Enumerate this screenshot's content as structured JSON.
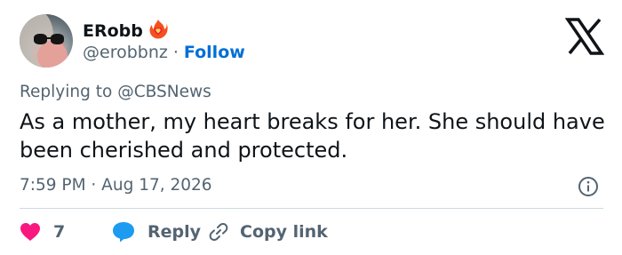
{
  "author": {
    "display_name": "ERobb",
    "handle": "@erobbnz",
    "separator": "·",
    "follow_label": "Follow",
    "badge_icon": "flame-heart-icon"
  },
  "brand": {
    "logo_icon": "x-logo-icon"
  },
  "reply_context": {
    "prefix": "Replying to",
    "mention": "@CBSNews"
  },
  "tweet": {
    "text": "As a mother, my heart breaks for her. She should have been cherished and protected.",
    "timestamp": "7:59 PM · Aug 17, 2026"
  },
  "actions": {
    "like_count": "7",
    "reply_label": "Reply",
    "copy_label": "Copy link"
  },
  "colors": {
    "link_blue": "#006fd6",
    "like_pink": "#f91880",
    "muted": "#536471",
    "text": "#0f1419",
    "reply_blue": "#1d9bf0"
  }
}
